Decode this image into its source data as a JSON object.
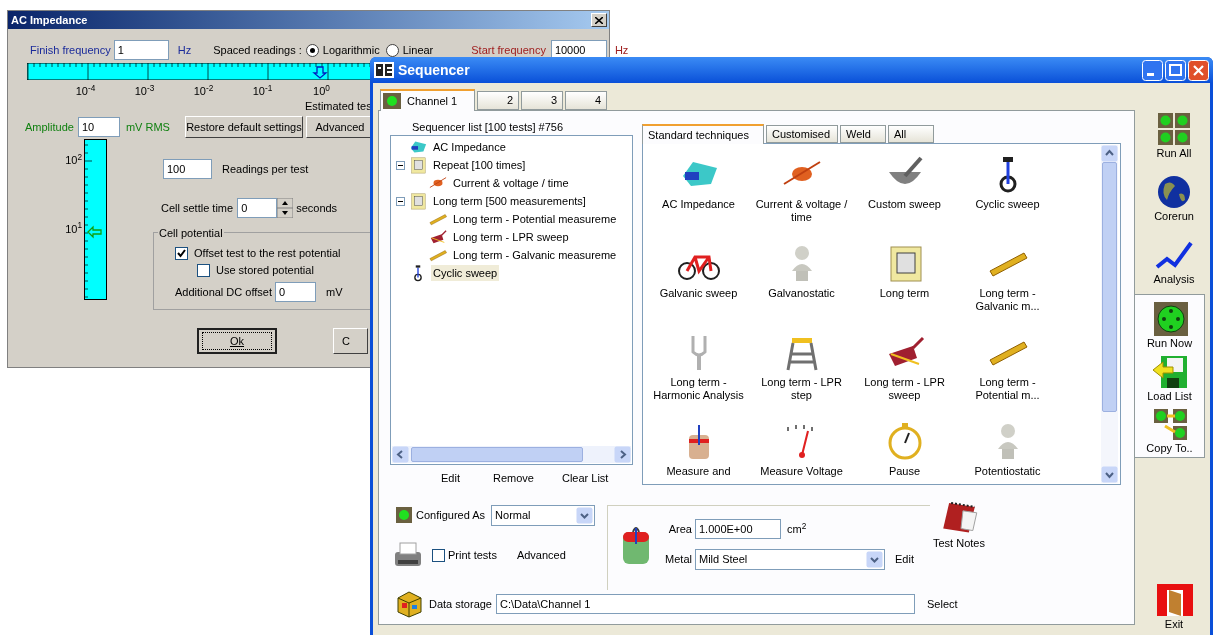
{
  "ac_impedance_window": {
    "title": "AC Impedance",
    "finish_frequency": {
      "label": "Finish frequency",
      "value": "1",
      "unit": "Hz"
    },
    "spaced_readings": {
      "label": "Spaced readings :",
      "options": [
        {
          "label": "Logarithmic",
          "selected": true
        },
        {
          "label": "Linear",
          "selected": false
        }
      ]
    },
    "start_frequency": {
      "label": "Start frequency",
      "value": "10000",
      "unit": "Hz"
    },
    "frequency_ticks": [
      "10$^{-4}$",
      "10$^{-3}$",
      "10$^{-2}$",
      "10$^{-1}$",
      "10$^{0}$"
    ],
    "estimated_text": "Estimated tes",
    "amplitude": {
      "label": "Amplitude",
      "value": "10",
      "unit": "mV RMS"
    },
    "buttons": [
      "Restore default settings",
      "Advanced"
    ],
    "amplitude_ticks": [
      "10$^{2}$",
      "10$^{1}$"
    ],
    "readings": {
      "value": "100",
      "label": "Readings per test"
    },
    "cell_settle_time": {
      "label": "Cell settle time",
      "value": "0",
      "unit": "seconds"
    },
    "cell_potential": {
      "title": "Cell potential",
      "options": [
        {
          "label": "Offset test to the rest potential",
          "checked": true
        },
        {
          "label": "Use stored potential",
          "checked": false
        }
      ],
      "dc_offset": {
        "label": "Additional DC offset",
        "value": "0",
        "unit": "mV"
      }
    },
    "footer_buttons": [
      "Ok",
      "C"
    ]
  },
  "sequencer_window": {
    "title": "Sequencer",
    "channel_tabs": [
      {
        "label": "Channel 1",
        "selected": true
      },
      {
        "label": "2",
        "selected": false
      },
      {
        "label": "3",
        "selected": false
      },
      {
        "label": "4",
        "selected": false
      }
    ],
    "list_title": "Sequencer list [100 tests] #756",
    "tree": [
      {
        "label": "AC Impedance",
        "selected": false
      },
      {
        "label": "Repeat [100 times]",
        "expanded": true,
        "selected": false,
        "children": [
          {
            "label": "Current & voltage / time",
            "selected": false
          }
        ]
      },
      {
        "label": "Long term [500 measurements]",
        "expanded": true,
        "selected": false,
        "children": [
          {
            "label": "Long term - Potential measureme",
            "selected": false
          },
          {
            "label": "Long term - LPR sweep",
            "selected": false
          },
          {
            "label": "Long term - Galvanic measureme",
            "selected": false
          }
        ]
      },
      {
        "label": "Cyclic sweep",
        "selected": true
      }
    ],
    "list_actions": [
      "Edit",
      "Remove",
      "Clear List"
    ],
    "technique_tabs": [
      {
        "label": "Standard techniques",
        "selected": true
      },
      {
        "label": "Customised",
        "selected": false
      },
      {
        "label": "Weld",
        "selected": false
      },
      {
        "label": "All",
        "selected": false
      }
    ],
    "techniques": [
      "AC Impedance",
      "Current & voltage / time",
      "Custom sweep",
      "Cyclic sweep",
      "Galvanic sweep",
      "Galvanostatic",
      "Long term",
      "Long term - Galvanic m...",
      "Long term - Harmonic Analysis",
      "Long term - LPR step",
      "Long term - LPR sweep",
      "Long term - Potential m...",
      "Measure and",
      "Measure Voltage",
      "Pause",
      "Potentiostatic"
    ],
    "configured_as": {
      "label": "Configured As",
      "value": "Normal"
    },
    "print_tests": {
      "label": "Print tests",
      "checked": false
    },
    "advanced": "Advanced",
    "area": {
      "label": "Area",
      "value": "1.000E+00",
      "unit": "cm$^{2}$"
    },
    "metal": {
      "label": "Metal",
      "value": "Mild Steel"
    },
    "metal_edit": "Edit",
    "test_notes": "Test Notes",
    "data_storage": {
      "label": "Data storage",
      "value": "C:\\Data\\Channel 1"
    },
    "select": "Select",
    "toolbar": [
      "Run All",
      "Corerun",
      "Analysis",
      "Run Now",
      "Load List",
      "Copy To..",
      "Exit"
    ]
  }
}
